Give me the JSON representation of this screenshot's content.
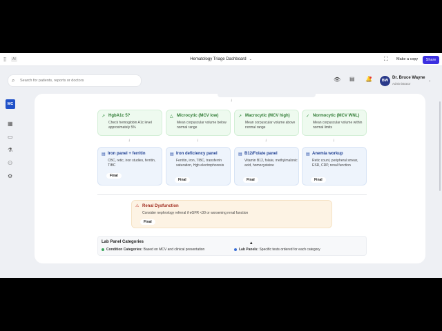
{
  "window": {
    "title": "Hematology Triage Dashboard",
    "ai_badge": "AI",
    "make_copy": "Make a copy",
    "share": "Share"
  },
  "search": {
    "placeholder": "Search for patients, reports or doctors"
  },
  "user": {
    "initials": "BW",
    "name": "Dr. Bruce Wayne",
    "role": "Administrator"
  },
  "sidebar": {
    "logo": "MC"
  },
  "conditions": [
    {
      "title": "HgbA1c 5?",
      "desc": "Check hemoglobin A1c level approximately 5%"
    },
    {
      "title": "Microcytic (MCV low)",
      "desc": "Mean corpuscular volume below normal range"
    },
    {
      "title": "Macrocytic (MCV high)",
      "desc": "Mean corpuscular volume above normal range"
    },
    {
      "title": "Normocytic (MCV WNL)",
      "desc": "Mean corpuscular volume within normal limits"
    }
  ],
  "labs": [
    {
      "title": "Iron panel + ferritin",
      "desc": "CBC, retic, iron studies, ferritin, TIBC",
      "status": "Final"
    },
    {
      "title": "Iron deficiency panel",
      "desc": "Ferritin, iron, TIBC, transferrin saturation, Hgb electrophoresis",
      "status": "Final"
    },
    {
      "title": "B12/Folate panel",
      "desc": "Vitamin B12, folate, methylmalonic acid, homocysteine",
      "status": "Final"
    },
    {
      "title": "Anemia workup",
      "desc": "Retic count, peripheral smear, ESR, CRP, renal function",
      "status": "Final"
    }
  ],
  "renal": {
    "title": "Renal Dysfunction",
    "desc": "Consider nephrology referral if eGFR <30 or worsening renal function",
    "status": "Final"
  },
  "legend": {
    "title": "Lab Panel Categories",
    "item1_label": "Condition Categories:",
    "item1_text": "Based on MCV and clinical presentation",
    "item2_label": "Lab Panels:",
    "item2_text": "Specific tests ordered for each category"
  },
  "colors": {
    "accent": "#3b2fe0",
    "brand": "#2051c8",
    "condition_green": "#2d7a32",
    "lab_blue": "#1e3f91",
    "alert_red": "#a12c1f"
  }
}
